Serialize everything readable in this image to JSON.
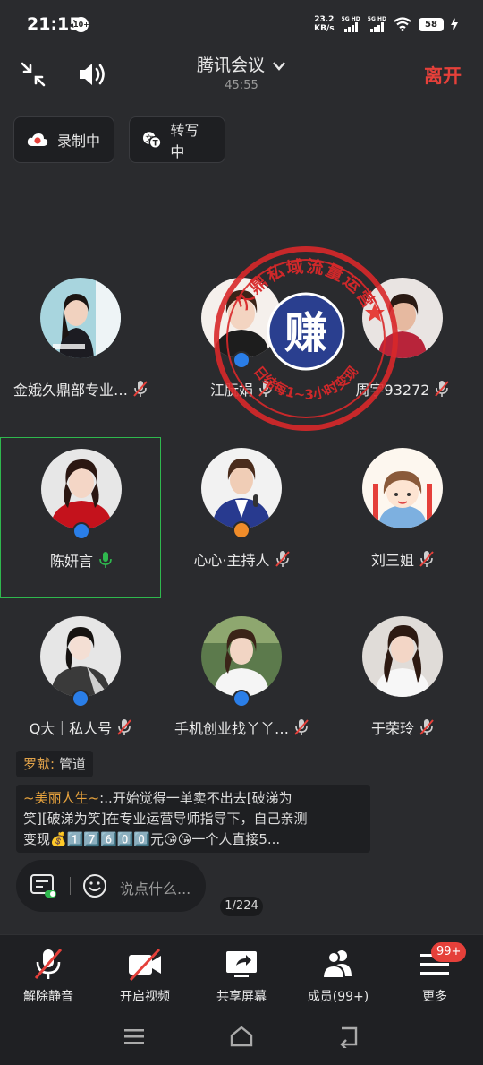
{
  "status": {
    "time": "21:15",
    "notif_badge": "10+",
    "net_speed_value": "23.2",
    "net_speed_unit": "KB/s",
    "sim1": "5G HD",
    "sim2": "5G HD",
    "battery": "58"
  },
  "header": {
    "title": "腾讯会议",
    "timer": "45:55",
    "leave_label": "离开"
  },
  "chips": {
    "recording": "录制中",
    "transcribing": "转写中"
  },
  "participants": [
    {
      "name": "金娥久鼎部专业…",
      "mic": "muted",
      "badge": "none"
    },
    {
      "name": "江朊娟",
      "mic": "muted",
      "badge": "blue"
    },
    {
      "name": "周宇93272",
      "mic": "muted",
      "badge": "none"
    },
    {
      "name": "陈妍言",
      "mic": "on",
      "badge": "blue",
      "active": true
    },
    {
      "name": "心心·主持人",
      "mic": "muted",
      "badge": "orange"
    },
    {
      "name": "刘三姐",
      "mic": "muted",
      "badge": "none"
    },
    {
      "name": "Q大｜私人号",
      "mic": "muted",
      "badge": "blue"
    },
    {
      "name": "手机创业找丫丫…",
      "mic": "muted",
      "badge": "blue"
    },
    {
      "name": "于荣玲",
      "mic": "muted",
      "badge": "none"
    }
  ],
  "stamp": {
    "top_text": "久鼎私域流量运营",
    "center_char": "赚",
    "bottom_text": "日结每1~3小时变现"
  },
  "chat": {
    "msg1_author": "罗献:",
    "msg1_text": "管道",
    "msg2_author": "~美丽人生~",
    "msg2_line1": ":..开始觉得一单卖不出去[破涕为",
    "msg2_line2": "笑][破涕为笑]在专业运营导师指导下，自己亲测",
    "msg2_line3": "变现💰1️⃣7️⃣6️⃣0️⃣0️⃣元😘😘一个人直接5..."
  },
  "chat_input": {
    "placeholder": "说点什么...",
    "page_indicator": "1/224"
  },
  "toolbar": {
    "unmute": "解除静音",
    "video": "开启视频",
    "share": "共享屏幕",
    "members": "成员(99+)",
    "more": "更多",
    "more_badge": "99+"
  },
  "colors": {
    "accent_red": "#e5403a",
    "active_green": "#2fb84e",
    "host_orange": "#f08c2a",
    "badge_blue": "#2a7ee8"
  }
}
